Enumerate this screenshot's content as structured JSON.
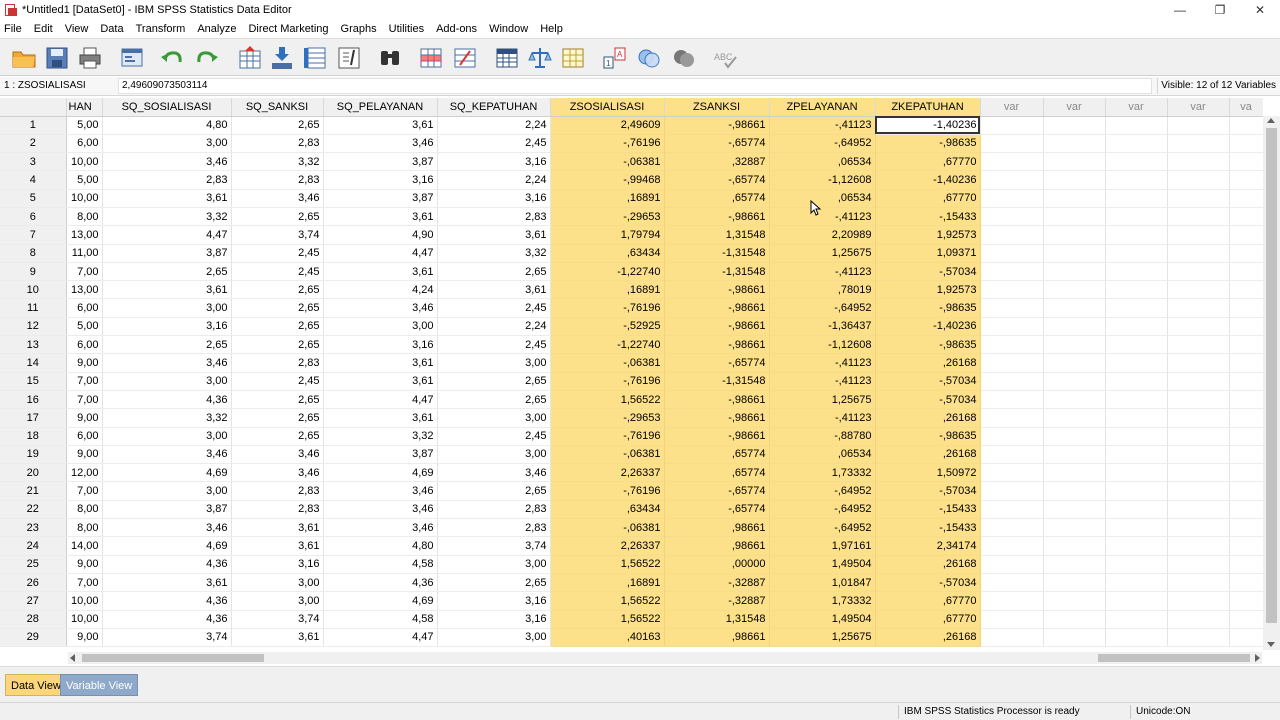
{
  "window": {
    "title": "*Untitled1 [DataSet0] - IBM SPSS Statistics Data Editor",
    "minimize": "—",
    "maximize": "❐",
    "close": "✕"
  },
  "menu": [
    "File",
    "Edit",
    "View",
    "Data",
    "Transform",
    "Analyze",
    "Direct Marketing",
    "Graphs",
    "Utilities",
    "Add-ons",
    "Window",
    "Help"
  ],
  "toolbar": {
    "icons": [
      "open-folder-icon",
      "save-icon",
      "print-icon",
      "dialog-recall-icon",
      "undo-icon",
      "redo-icon",
      "go-to-case-icon",
      "go-to-variable-icon",
      "variables-icon",
      "run-descriptives-icon",
      "find-icon",
      "insert-cases-icon",
      "insert-variable-icon",
      "split-file-icon",
      "weight-cases-icon",
      "select-cases-icon",
      "value-labels-icon",
      "use-sets-icon",
      "show-all-variables-icon",
      "spell-check-icon"
    ],
    "spellcheck_text": "ABC"
  },
  "editor": {
    "cell_ref": "1 : ZSOSIALISASI",
    "cell_value": "2,49609073503114",
    "visible": "Visible: 12 of 12 Variables"
  },
  "columns": [
    "HAN",
    "SQ_SOSIALISASI",
    "SQ_SANKSI",
    "SQ_PELAYANAN",
    "SQ_KEPATUHAN",
    "ZSOSIALISASI",
    "ZSANKSI",
    "ZPELAYANAN",
    "ZKEPATUHAN",
    "var",
    "var",
    "var",
    "var",
    "va"
  ],
  "rows": [
    [
      "1",
      "5,00",
      "4,80",
      "2,65",
      "3,61",
      "2,24",
      "2,49609",
      "-,98661",
      "-,41123",
      "-1,40236"
    ],
    [
      "2",
      "6,00",
      "3,00",
      "2,83",
      "3,46",
      "2,45",
      "-,76196",
      "-,65774",
      "-,64952",
      "-,98635"
    ],
    [
      "3",
      "10,00",
      "3,46",
      "3,32",
      "3,87",
      "3,16",
      "-,06381",
      ",32887",
      ",06534",
      ",67770"
    ],
    [
      "4",
      "5,00",
      "2,83",
      "2,83",
      "3,16",
      "2,24",
      "-,99468",
      "-,65774",
      "-1,12608",
      "-1,40236"
    ],
    [
      "5",
      "10,00",
      "3,61",
      "3,46",
      "3,87",
      "3,16",
      ",16891",
      ",65774",
      ",06534",
      ",67770"
    ],
    [
      "6",
      "8,00",
      "3,32",
      "2,65",
      "3,61",
      "2,83",
      "-,29653",
      "-,98661",
      "-,41123",
      "-,15433"
    ],
    [
      "7",
      "13,00",
      "4,47",
      "3,74",
      "4,90",
      "3,61",
      "1,79794",
      "1,31548",
      "2,20989",
      "1,92573"
    ],
    [
      "8",
      "11,00",
      "3,87",
      "2,45",
      "4,47",
      "3,32",
      ",63434",
      "-1,31548",
      "1,25675",
      "1,09371"
    ],
    [
      "9",
      "7,00",
      "2,65",
      "2,45",
      "3,61",
      "2,65",
      "-1,22740",
      "-1,31548",
      "-,41123",
      "-,57034"
    ],
    [
      "10",
      "13,00",
      "3,61",
      "2,65",
      "4,24",
      "3,61",
      ",16891",
      "-,98661",
      ",78019",
      "1,92573"
    ],
    [
      "11",
      "6,00",
      "3,00",
      "2,65",
      "3,46",
      "2,45",
      "-,76196",
      "-,98661",
      "-,64952",
      "-,98635"
    ],
    [
      "12",
      "5,00",
      "3,16",
      "2,65",
      "3,00",
      "2,24",
      "-,52925",
      "-,98661",
      "-1,36437",
      "-1,40236"
    ],
    [
      "13",
      "6,00",
      "2,65",
      "2,65",
      "3,16",
      "2,45",
      "-1,22740",
      "-,98661",
      "-1,12608",
      "-,98635"
    ],
    [
      "14",
      "9,00",
      "3,46",
      "2,83",
      "3,61",
      "3,00",
      "-,06381",
      "-,65774",
      "-,41123",
      ",26168"
    ],
    [
      "15",
      "7,00",
      "3,00",
      "2,45",
      "3,61",
      "2,65",
      "-,76196",
      "-1,31548",
      "-,41123",
      "-,57034"
    ],
    [
      "16",
      "7,00",
      "4,36",
      "2,65",
      "4,47",
      "2,65",
      "1,56522",
      "-,98661",
      "1,25675",
      "-,57034"
    ],
    [
      "17",
      "9,00",
      "3,32",
      "2,65",
      "3,61",
      "3,00",
      "-,29653",
      "-,98661",
      "-,41123",
      ",26168"
    ],
    [
      "18",
      "6,00",
      "3,00",
      "2,65",
      "3,32",
      "2,45",
      "-,76196",
      "-,98661",
      "-,88780",
      "-,98635"
    ],
    [
      "19",
      "9,00",
      "3,46",
      "3,46",
      "3,87",
      "3,00",
      "-,06381",
      ",65774",
      ",06534",
      ",26168"
    ],
    [
      "20",
      "12,00",
      "4,69",
      "3,46",
      "4,69",
      "3,46",
      "2,26337",
      ",65774",
      "1,73332",
      "1,50972"
    ],
    [
      "21",
      "7,00",
      "3,00",
      "2,83",
      "3,46",
      "2,65",
      "-,76196",
      "-,65774",
      "-,64952",
      "-,57034"
    ],
    [
      "22",
      "8,00",
      "3,87",
      "2,83",
      "3,46",
      "2,83",
      ",63434",
      "-,65774",
      "-,64952",
      "-,15433"
    ],
    [
      "23",
      "8,00",
      "3,46",
      "3,61",
      "3,46",
      "2,83",
      "-,06381",
      ",98661",
      "-,64952",
      "-,15433"
    ],
    [
      "24",
      "14,00",
      "4,69",
      "3,61",
      "4,80",
      "3,74",
      "2,26337",
      ",98661",
      "1,97161",
      "2,34174"
    ],
    [
      "25",
      "9,00",
      "4,36",
      "3,16",
      "4,58",
      "3,00",
      "1,56522",
      ",00000",
      "1,49504",
      ",26168"
    ],
    [
      "26",
      "7,00",
      "3,61",
      "3,00",
      "4,36",
      "2,65",
      ",16891",
      "-,32887",
      "1,01847",
      "-,57034"
    ],
    [
      "27",
      "10,00",
      "4,36",
      "3,00",
      "4,69",
      "3,16",
      "1,56522",
      "-,32887",
      "1,73332",
      ",67770"
    ],
    [
      "28",
      "10,00",
      "4,36",
      "3,74",
      "4,58",
      "3,16",
      "1,56522",
      "1,31548",
      "1,49504",
      ",67770"
    ],
    [
      "29",
      "9,00",
      "3,74",
      "3,61",
      "4,47",
      "3,00",
      ",40163",
      ",98661",
      "1,25675",
      ",26168"
    ]
  ],
  "tabs": {
    "data_view": "Data View",
    "variable_view": "Variable View"
  },
  "status": {
    "processor": "IBM SPSS Statistics Processor is ready",
    "unicode": "Unicode:ON"
  },
  "colors": {
    "highlight": "#fde08a",
    "active_tab": "#fcd67a",
    "inactive_tab": "#8ea9c9"
  }
}
